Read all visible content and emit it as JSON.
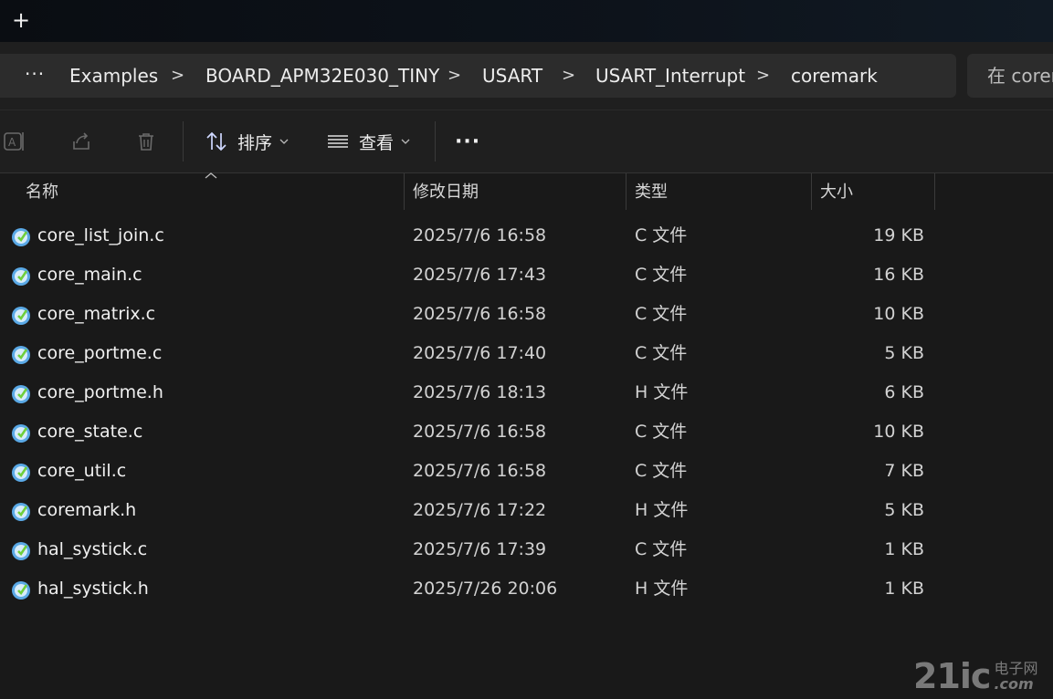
{
  "tabbar": {
    "new_tab": "+"
  },
  "breadcrumb": {
    "more": "···",
    "separator": ">",
    "items": [
      "Examples",
      "BOARD_APM32E030_TINY",
      "USART",
      "USART_Interrupt",
      "coremark"
    ]
  },
  "search": {
    "placeholder": "在 coremark 中搜索"
  },
  "toolbar": {
    "sort_label": "排序",
    "view_label": "查看",
    "more_label": "···"
  },
  "columns": {
    "name": "名称",
    "date": "修改日期",
    "type": "类型",
    "size": "大小"
  },
  "files": [
    {
      "name": "core_list_join.c",
      "date": "2025/7/6 16:58",
      "type": "C 文件",
      "size": "19 KB"
    },
    {
      "name": "core_main.c",
      "date": "2025/7/6 17:43",
      "type": "C 文件",
      "size": "16 KB"
    },
    {
      "name": "core_matrix.c",
      "date": "2025/7/6 16:58",
      "type": "C 文件",
      "size": "10 KB"
    },
    {
      "name": "core_portme.c",
      "date": "2025/7/6 17:40",
      "type": "C 文件",
      "size": "5 KB"
    },
    {
      "name": "core_portme.h",
      "date": "2025/7/6 18:13",
      "type": "H 文件",
      "size": "6 KB"
    },
    {
      "name": "core_state.c",
      "date": "2025/7/6 16:58",
      "type": "C 文件",
      "size": "10 KB"
    },
    {
      "name": "core_util.c",
      "date": "2025/7/6 16:58",
      "type": "C 文件",
      "size": "7 KB"
    },
    {
      "name": "coremark.h",
      "date": "2025/7/6 17:22",
      "type": "H 文件",
      "size": "5 KB"
    },
    {
      "name": "hal_systick.c",
      "date": "2025/7/6 17:39",
      "type": "C 文件",
      "size": "1 KB"
    },
    {
      "name": "hal_systick.h",
      "date": "2025/7/26 20:06",
      "type": "H 文件",
      "size": "1 KB"
    }
  ],
  "watermark": {
    "main": "21ic",
    "cn": "电子网",
    "com": ".com"
  },
  "colors": {
    "background": "#191919",
    "bar": "#2c2c2c",
    "file_icon": "#5aa9e6",
    "file_icon_check": "#6fcf3c"
  },
  "icons": [
    "ai-rename-icon",
    "share-icon",
    "delete-icon",
    "sort-icon",
    "view-list-icon",
    "file-icon"
  ]
}
